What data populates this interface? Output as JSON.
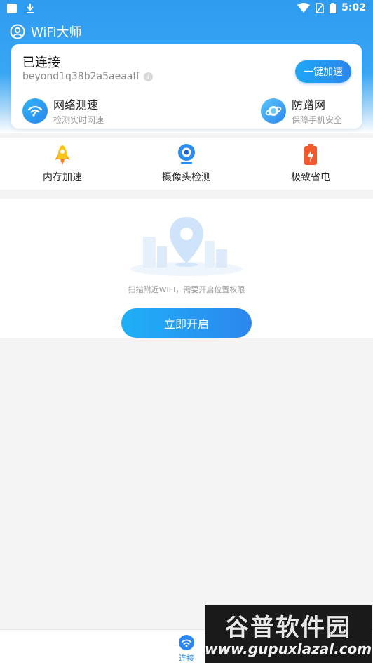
{
  "status_bar": {
    "time": "5:02"
  },
  "app_bar": {
    "title": "WiFi大师",
    "icon": "user-circle-icon"
  },
  "connection_card": {
    "status": "已连接",
    "ssid": "beyond1q38b2a5aeaaff",
    "boost_button": "一键加速",
    "features": [
      {
        "title": "网络测速",
        "subtitle": "检测实时网速",
        "icon": "speedtest-wifi-icon"
      },
      {
        "title": "防蹭网",
        "subtitle": "保障手机安全",
        "icon": "shield-planet-icon"
      }
    ]
  },
  "tools": [
    {
      "label": "内存加速",
      "icon": "rocket-icon"
    },
    {
      "label": "摄像头检测",
      "icon": "camera-icon"
    },
    {
      "label": "极致省电",
      "icon": "battery-icon"
    }
  ],
  "scan_panel": {
    "hint": "扫描附近WIFI，需要开启位置权限",
    "button": "立即开启"
  },
  "bottom_nav": {
    "label": "连接",
    "icon": "wifi-icon"
  },
  "watermark": {
    "top": "谷普软件园",
    "bottom": "www.gupuxlazal.com"
  },
  "colors": {
    "primary": "#2b86ee",
    "header": "#39a6f4"
  }
}
